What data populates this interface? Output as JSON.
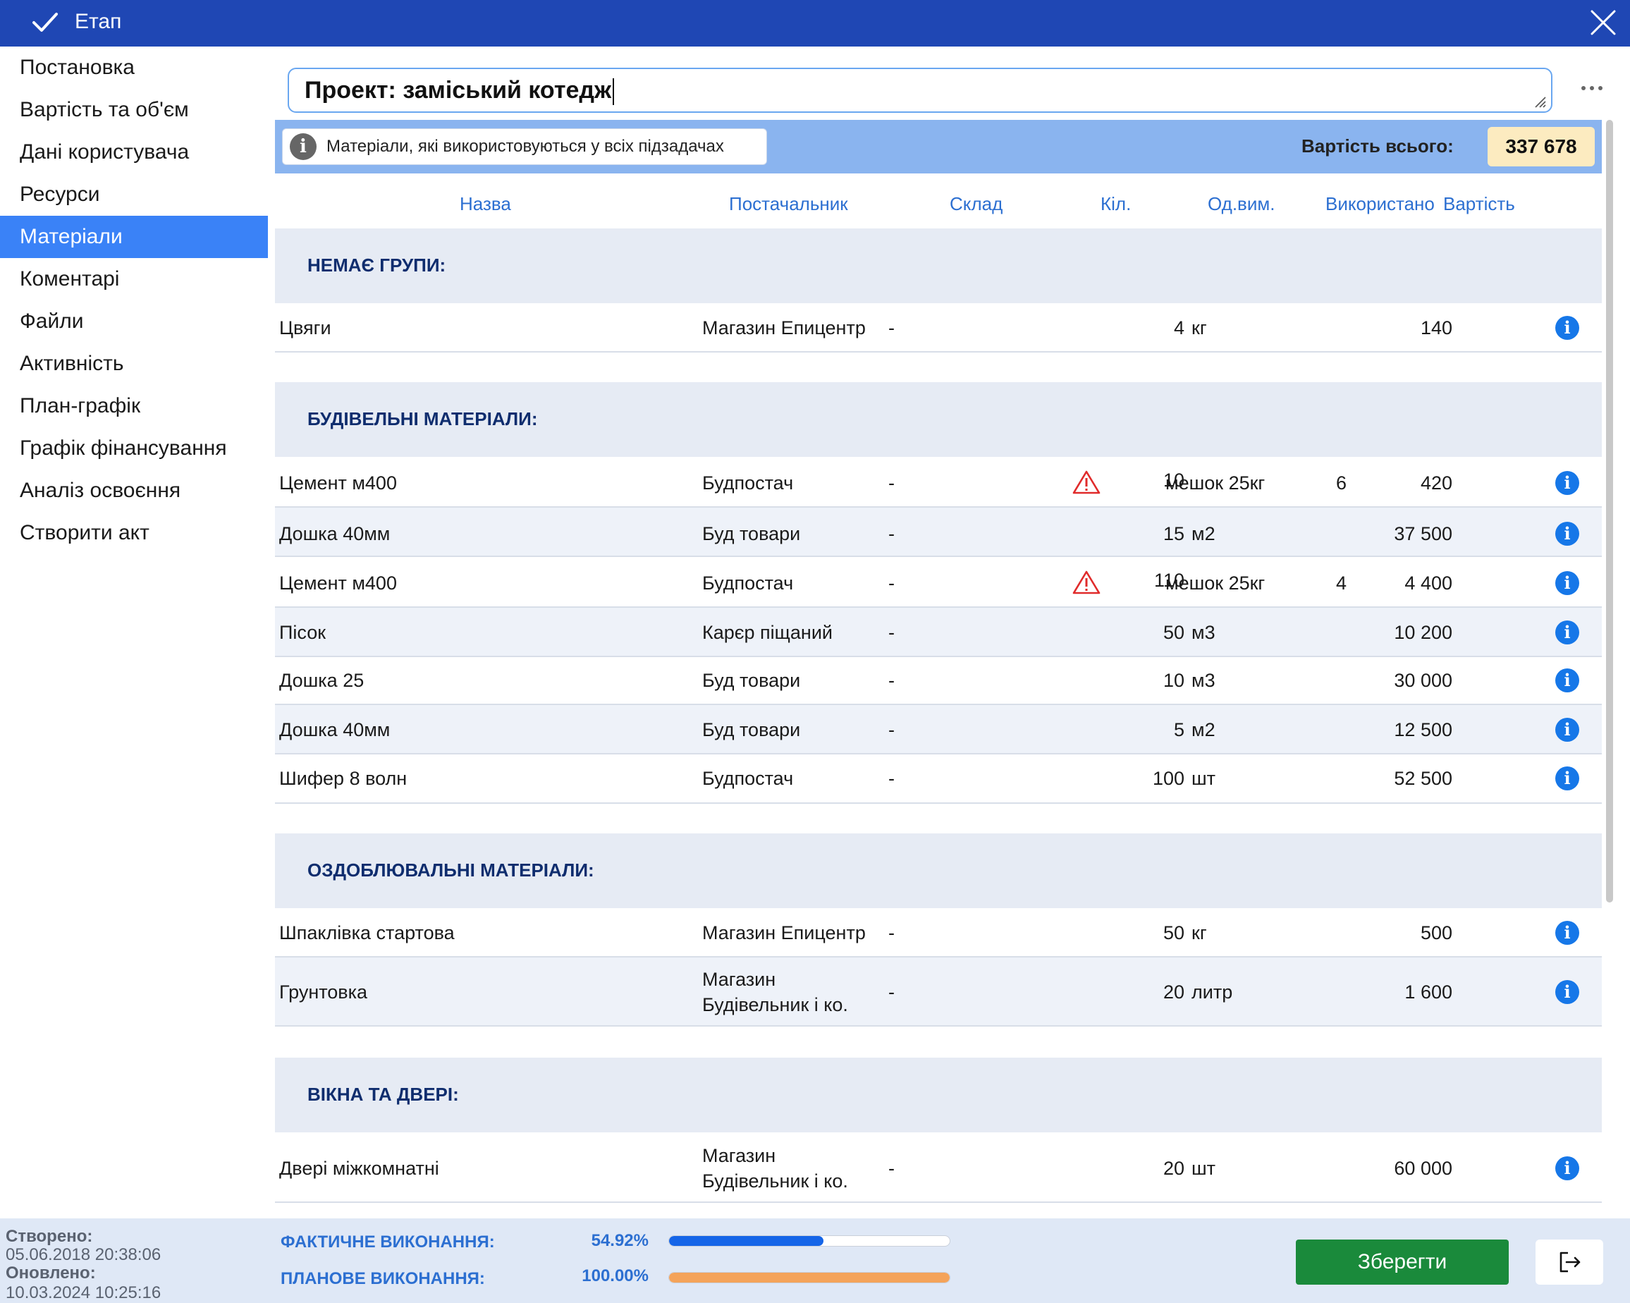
{
  "window": {
    "title": "Етап"
  },
  "sidebar": {
    "items": [
      {
        "label": "Постановка"
      },
      {
        "label": "Вартість та об'єм"
      },
      {
        "label": "Дані користувача"
      },
      {
        "label": "Ресурси"
      },
      {
        "label": "Матеріали",
        "active": true
      },
      {
        "label": "Коментарі"
      },
      {
        "label": "Файли"
      },
      {
        "label": "Активність"
      },
      {
        "label": "План-графік"
      },
      {
        "label": "Графік фінансування"
      },
      {
        "label": "Аналіз освоєння"
      },
      {
        "label": "Створити акт"
      }
    ]
  },
  "project": {
    "value": "Проект: заміський котедж"
  },
  "banner": {
    "info_text": "Матеріали, які використовуються у всіх підзадачах",
    "total_label": "Вартість всього:",
    "total_value": "337 678"
  },
  "columns": {
    "name": "Назва",
    "supplier": "Постачальник",
    "warehouse": "Склад",
    "qty": "Кіл.",
    "unit": "Од.вим.",
    "used": "Використано",
    "cost": "Вартість"
  },
  "groups": [
    {
      "name": "НЕМАЄ ГРУПИ:",
      "rows": [
        {
          "name": "Цвяги",
          "supplier": "Магазин Епицентр",
          "warehouse": "-",
          "qty": "4",
          "unit": "кг",
          "used": "",
          "cost": "140",
          "warn": false
        }
      ]
    },
    {
      "name": "БУДІВЕЛЬНІ МАТЕРІАЛИ:",
      "rows": [
        {
          "name": "Цемент м400",
          "supplier": "Будпостач",
          "warehouse": "-",
          "qty": "10",
          "unit": "мешок 25кг",
          "used": "6",
          "cost": "420",
          "warn": true
        },
        {
          "name": "Дошка 40мм",
          "supplier": "Буд товари",
          "warehouse": "-",
          "qty": "15",
          "unit": "м2",
          "used": "",
          "cost": "37 500",
          "warn": false
        },
        {
          "name": "Цемент м400",
          "supplier": "Будпостач",
          "warehouse": "-",
          "qty": "110",
          "unit": "мешок 25кг",
          "used": "4",
          "cost": "4 400",
          "warn": true
        },
        {
          "name": "Пісок",
          "supplier": "Карєр піщаний",
          "warehouse": "-",
          "qty": "50",
          "unit": "м3",
          "used": "",
          "cost": "10 200",
          "warn": false
        },
        {
          "name": "Дошка 25",
          "supplier": "Буд товари",
          "warehouse": "-",
          "qty": "10",
          "unit": "м3",
          "used": "",
          "cost": "30 000",
          "warn": false
        },
        {
          "name": "Дошка 40мм",
          "supplier": "Буд товари",
          "warehouse": "-",
          "qty": "5",
          "unit": "м2",
          "used": "",
          "cost": "12 500",
          "warn": false
        },
        {
          "name": "Шифер 8 волн",
          "supplier": "Будпостач",
          "warehouse": "-",
          "qty": "100",
          "unit": "шт",
          "used": "",
          "cost": "52 500",
          "warn": false
        }
      ]
    },
    {
      "name": "ОЗДОБЛЮВАЛЬНІ МАТЕРІАЛИ:",
      "rows": [
        {
          "name": "Шпаклівка стартова",
          "supplier": "Магазин Епицентр",
          "warehouse": "-",
          "qty": "50",
          "unit": "кг",
          "used": "",
          "cost": "500",
          "warn": false
        },
        {
          "name": "Грунтовка",
          "supplier_line1": "Магазин",
          "supplier_line2": "Будівельник і ко.",
          "warehouse": "-",
          "qty": "20",
          "unit": "литр",
          "used": "",
          "cost": "1 600",
          "warn": false
        }
      ]
    },
    {
      "name": "ВІКНА ТА ДВЕРІ:",
      "rows": [
        {
          "name": "Двері міжкомнатні",
          "supplier_line1": "Магазин",
          "supplier_line2": "Будівельник і ко.",
          "warehouse": "-",
          "qty": "20",
          "unit": "шт",
          "used": "",
          "cost": "60 000",
          "warn": false
        }
      ]
    }
  ],
  "footer": {
    "created_label": "Створено:",
    "created_value": "05.06.2018 20:38:06",
    "updated_label": "Оновлено:",
    "updated_value": "10.03.2024 10:25:16",
    "actual_label": "ФАКТИЧНЕ ВИКОНАННЯ:",
    "actual_value": "54.92%",
    "actual_fraction": 0.5492,
    "planned_label": "ПЛАНОВЕ ВИКОНАННЯ:",
    "planned_value": "100.00%",
    "planned_fraction": 1.0,
    "save_label": "Зберегти"
  },
  "colors": {
    "titlebar": "#1f47b4",
    "accent": "#3a82f7",
    "actual_bar": "#1565e8",
    "planned_bar": "#f4a35a",
    "save": "#1a8a3b"
  },
  "icons": {
    "check": "check-icon",
    "close": "close-icon",
    "more": "more-icon",
    "info": "info-icon",
    "warning": "warning-icon",
    "exit": "exit-icon"
  }
}
